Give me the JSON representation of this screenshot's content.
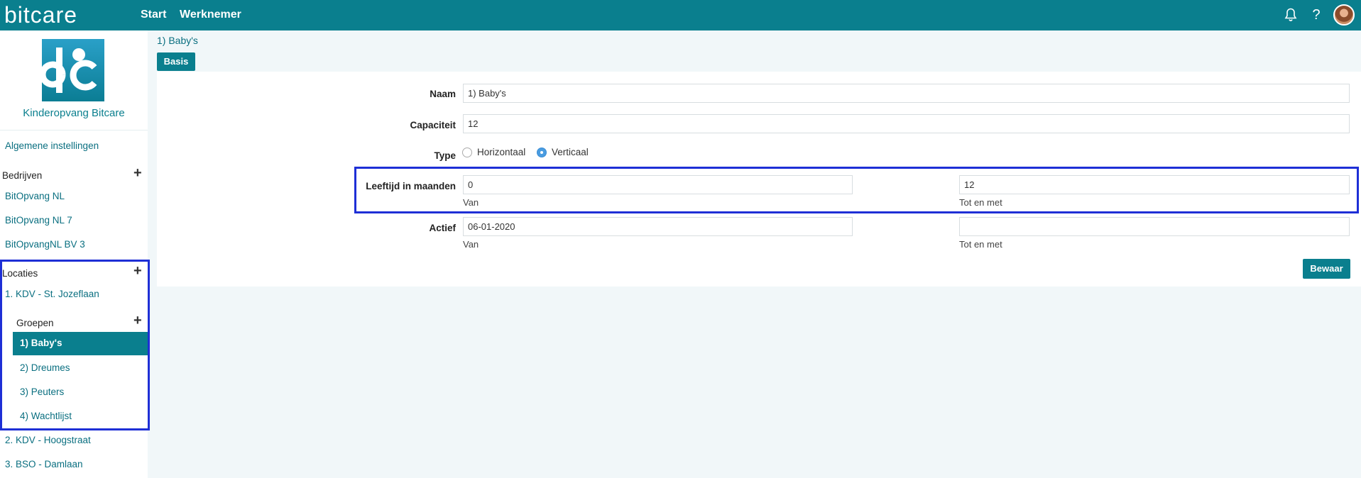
{
  "topbar": {
    "brand": "bitcare",
    "nav": [
      {
        "label": "Start"
      },
      {
        "label": "Werknemer"
      }
    ],
    "help_label": "?"
  },
  "sidebar": {
    "company_name": "Kinderopvang Bitcare",
    "general_settings": "Algemene instellingen",
    "companies_heading": "Bedrijven",
    "companies": [
      "BitOpvang NL",
      "BitOpvang NL 7",
      "BitOpvangNL BV 3"
    ],
    "locations_heading": "Locaties",
    "locations": [
      "1. KDV - St. Jozeflaan",
      "2. KDV - Hoogstraat",
      "3. BSO - Damlaan"
    ],
    "groups_heading": "Groepen",
    "groups": [
      "1) Baby's",
      "2) Dreumes",
      "3) Peuters",
      "4) Wachtlijst"
    ],
    "plus_label": "+"
  },
  "main": {
    "breadcrumb": "1) Baby's",
    "tab": "Basis",
    "form": {
      "naam_label": "Naam",
      "naam_value": "1) Baby's",
      "capaciteit_label": "Capaciteit",
      "capaciteit_value": "12",
      "type_label": "Type",
      "type_options": [
        "Horizontaal",
        "Verticaal"
      ],
      "type_selected": "Verticaal",
      "leeftijd_label": "Leeftijd in maanden",
      "leeftijd_from": "0",
      "leeftijd_to": "12",
      "van_label": "Van",
      "tot_label": "Tot en met",
      "actief_label": "Actief",
      "actief_from": "06-01-2020",
      "actief_to": ""
    },
    "save_label": "Bewaar"
  },
  "colors": {
    "primary": "#0a7f8e",
    "highlight": "#1e2fd6"
  }
}
